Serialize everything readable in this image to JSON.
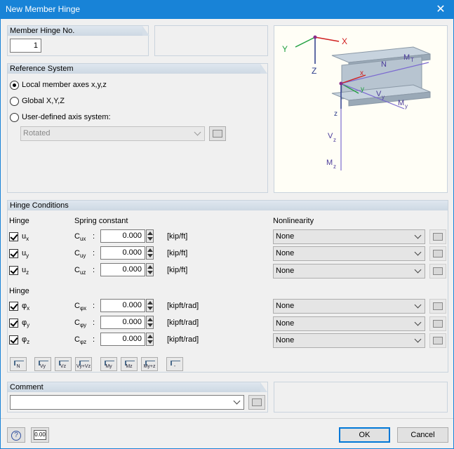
{
  "window": {
    "title": "New Member Hinge"
  },
  "hinge_no": {
    "header": "Member Hinge No.",
    "value": "1"
  },
  "reference": {
    "header": "Reference System",
    "options": [
      "Local member axes x,y,z",
      "Global X,Y,Z",
      "User-defined axis system:"
    ],
    "selected_index": 0,
    "axis_system_value": "Rotated"
  },
  "diagram": {
    "labels": {
      "X": "X",
      "Y": "Y",
      "Z": "Z",
      "x": "x",
      "y": "y",
      "z": "z",
      "N": "N",
      "Vy": "V",
      "Vz": "V",
      "Mt": "M",
      "My": "M",
      "Mz": "M"
    },
    "subs": {
      "T": "T",
      "y": "y",
      "z": "z"
    }
  },
  "conditions": {
    "header": "Hinge Conditions",
    "col_hinge": "Hinge",
    "col_spring": "Spring constant",
    "col_nonlin": "Nonlinearity",
    "rows1": [
      {
        "hinge": "u",
        "sub": "x",
        "c": "C",
        "csub": "ux",
        "value": "0.000",
        "unit": "[kip/ft]",
        "nonlin": "None"
      },
      {
        "hinge": "u",
        "sub": "y",
        "c": "C",
        "csub": "uy",
        "value": "0.000",
        "unit": "[kip/ft]",
        "nonlin": "None"
      },
      {
        "hinge": "u",
        "sub": "z",
        "c": "C",
        "csub": "uz",
        "value": "0.000",
        "unit": "[kip/ft]",
        "nonlin": "None"
      }
    ],
    "hinge2_label": "Hinge",
    "rows2": [
      {
        "hinge": "φ",
        "sub": "x",
        "c": "C",
        "csub": "φx",
        "value": "0.000",
        "unit": "[kipft/rad]",
        "nonlin": "None"
      },
      {
        "hinge": "φ",
        "sub": "y",
        "c": "C",
        "csub": "φy",
        "value": "0.000",
        "unit": "[kipft/rad]",
        "nonlin": "None"
      },
      {
        "hinge": "φ",
        "sub": "z",
        "c": "C",
        "csub": "φz",
        "value": "0.000",
        "unit": "[kipft/rad]",
        "nonlin": "None"
      }
    ],
    "toolbar": [
      "N",
      "Vy",
      "Vz",
      "Vy+Vz",
      "My",
      "Mz",
      "My+z",
      "-"
    ]
  },
  "comment": {
    "header": "Comment",
    "value": ""
  },
  "footer": {
    "ok": "OK",
    "cancel": "Cancel",
    "units_label": "0.00"
  }
}
